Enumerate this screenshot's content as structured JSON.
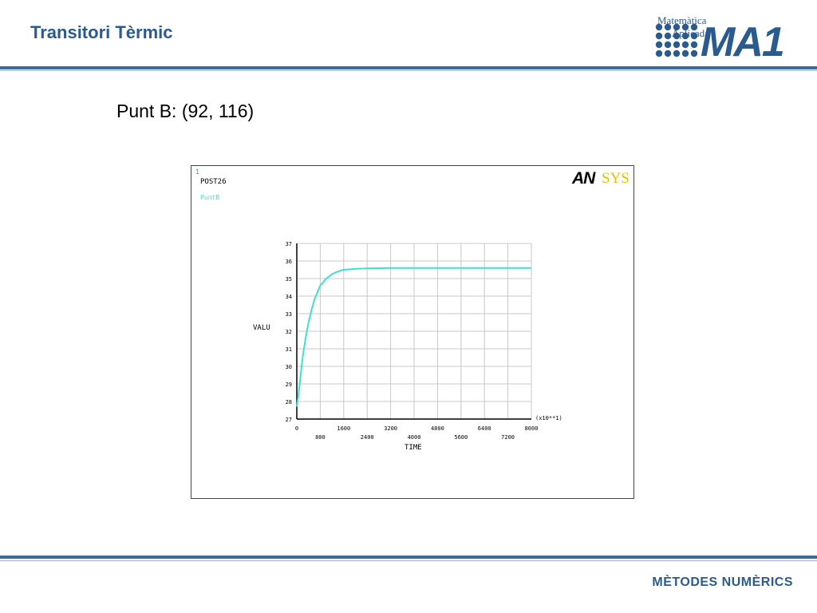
{
  "slide": {
    "title": "Transitori Tèrmic",
    "subtitle": "Punt B: (92, 116)",
    "footer": "MÈTODES NUMÈRICS"
  },
  "logo": {
    "line1": "Matemàtica",
    "line2": "Aplicada",
    "mark": "MA1"
  },
  "plot_header": {
    "window_number": "1",
    "post_label": "POST26",
    "variable_label": "PuntB",
    "brand_left": "AN",
    "brand_right": "SYS"
  },
  "chart_data": {
    "type": "line",
    "xlabel": "TIME",
    "ylabel": "VALU",
    "x_multiplier": "(x10**1)",
    "xlim": [
      0,
      8000
    ],
    "ylim": [
      27,
      37
    ],
    "x_ticks_top": [
      "0",
      "1600",
      "3200",
      "4800",
      "6400",
      "8000"
    ],
    "x_ticks_bottom": [
      "800",
      "2400",
      "4000",
      "5600",
      "7200"
    ],
    "y_ticks": [
      "27",
      "28",
      "29",
      "30",
      "31",
      "32",
      "33",
      "34",
      "35",
      "36",
      "37"
    ],
    "grid": true,
    "series": [
      {
        "name": "PuntB",
        "color": "#40e0d0",
        "x": [
          0,
          50,
          100,
          150,
          200,
          300,
          400,
          500,
          600,
          700,
          800,
          1000,
          1200,
          1400,
          1600,
          2000,
          2400,
          3200,
          4000,
          4800,
          5600,
          6400,
          7200,
          8000
        ],
        "y": [
          27.7,
          28.3,
          29.0,
          29.8,
          30.5,
          31.6,
          32.5,
          33.2,
          33.8,
          34.2,
          34.6,
          35.0,
          35.25,
          35.4,
          35.5,
          35.55,
          35.58,
          35.6,
          35.6,
          35.6,
          35.6,
          35.6,
          35.6,
          35.6
        ]
      }
    ]
  },
  "colors": {
    "title": "#2a5b8f",
    "rule": "#3d6b98",
    "curve": "#40e0d0",
    "grid": "#c8c8c8",
    "brand_right": "#e3c200"
  }
}
